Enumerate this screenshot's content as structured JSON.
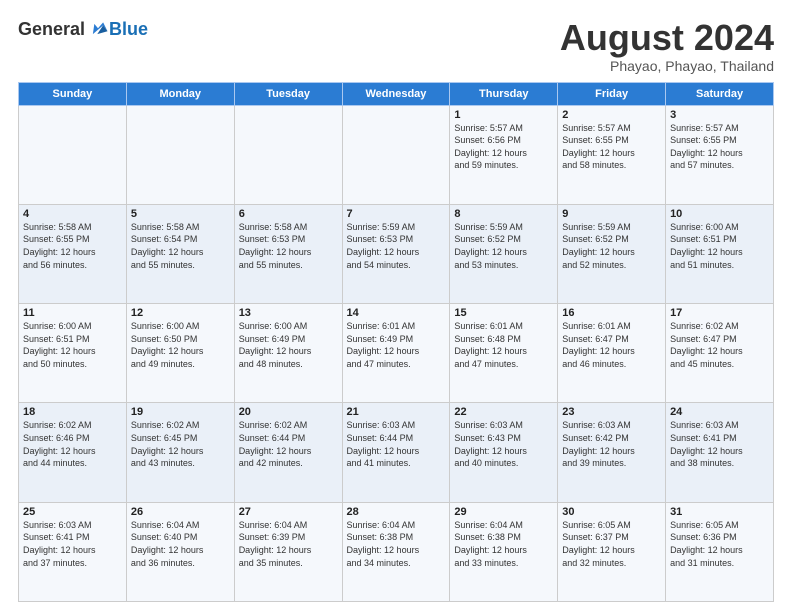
{
  "logo": {
    "general": "General",
    "blue": "Blue"
  },
  "title": {
    "month": "August 2024",
    "location": "Phayao, Phayao, Thailand"
  },
  "days_of_week": [
    "Sunday",
    "Monday",
    "Tuesday",
    "Wednesday",
    "Thursday",
    "Friday",
    "Saturday"
  ],
  "weeks": [
    [
      {
        "day": "",
        "info": ""
      },
      {
        "day": "",
        "info": ""
      },
      {
        "day": "",
        "info": ""
      },
      {
        "day": "",
        "info": ""
      },
      {
        "day": "1",
        "info": "Sunrise: 5:57 AM\nSunset: 6:56 PM\nDaylight: 12 hours\nand 59 minutes."
      },
      {
        "day": "2",
        "info": "Sunrise: 5:57 AM\nSunset: 6:55 PM\nDaylight: 12 hours\nand 58 minutes."
      },
      {
        "day": "3",
        "info": "Sunrise: 5:57 AM\nSunset: 6:55 PM\nDaylight: 12 hours\nand 57 minutes."
      }
    ],
    [
      {
        "day": "4",
        "info": "Sunrise: 5:58 AM\nSunset: 6:55 PM\nDaylight: 12 hours\nand 56 minutes."
      },
      {
        "day": "5",
        "info": "Sunrise: 5:58 AM\nSunset: 6:54 PM\nDaylight: 12 hours\nand 55 minutes."
      },
      {
        "day": "6",
        "info": "Sunrise: 5:58 AM\nSunset: 6:53 PM\nDaylight: 12 hours\nand 55 minutes."
      },
      {
        "day": "7",
        "info": "Sunrise: 5:59 AM\nSunset: 6:53 PM\nDaylight: 12 hours\nand 54 minutes."
      },
      {
        "day": "8",
        "info": "Sunrise: 5:59 AM\nSunset: 6:52 PM\nDaylight: 12 hours\nand 53 minutes."
      },
      {
        "day": "9",
        "info": "Sunrise: 5:59 AM\nSunset: 6:52 PM\nDaylight: 12 hours\nand 52 minutes."
      },
      {
        "day": "10",
        "info": "Sunrise: 6:00 AM\nSunset: 6:51 PM\nDaylight: 12 hours\nand 51 minutes."
      }
    ],
    [
      {
        "day": "11",
        "info": "Sunrise: 6:00 AM\nSunset: 6:51 PM\nDaylight: 12 hours\nand 50 minutes."
      },
      {
        "day": "12",
        "info": "Sunrise: 6:00 AM\nSunset: 6:50 PM\nDaylight: 12 hours\nand 49 minutes."
      },
      {
        "day": "13",
        "info": "Sunrise: 6:00 AM\nSunset: 6:49 PM\nDaylight: 12 hours\nand 48 minutes."
      },
      {
        "day": "14",
        "info": "Sunrise: 6:01 AM\nSunset: 6:49 PM\nDaylight: 12 hours\nand 47 minutes."
      },
      {
        "day": "15",
        "info": "Sunrise: 6:01 AM\nSunset: 6:48 PM\nDaylight: 12 hours\nand 47 minutes."
      },
      {
        "day": "16",
        "info": "Sunrise: 6:01 AM\nSunset: 6:47 PM\nDaylight: 12 hours\nand 46 minutes."
      },
      {
        "day": "17",
        "info": "Sunrise: 6:02 AM\nSunset: 6:47 PM\nDaylight: 12 hours\nand 45 minutes."
      }
    ],
    [
      {
        "day": "18",
        "info": "Sunrise: 6:02 AM\nSunset: 6:46 PM\nDaylight: 12 hours\nand 44 minutes."
      },
      {
        "day": "19",
        "info": "Sunrise: 6:02 AM\nSunset: 6:45 PM\nDaylight: 12 hours\nand 43 minutes."
      },
      {
        "day": "20",
        "info": "Sunrise: 6:02 AM\nSunset: 6:44 PM\nDaylight: 12 hours\nand 42 minutes."
      },
      {
        "day": "21",
        "info": "Sunrise: 6:03 AM\nSunset: 6:44 PM\nDaylight: 12 hours\nand 41 minutes."
      },
      {
        "day": "22",
        "info": "Sunrise: 6:03 AM\nSunset: 6:43 PM\nDaylight: 12 hours\nand 40 minutes."
      },
      {
        "day": "23",
        "info": "Sunrise: 6:03 AM\nSunset: 6:42 PM\nDaylight: 12 hours\nand 39 minutes."
      },
      {
        "day": "24",
        "info": "Sunrise: 6:03 AM\nSunset: 6:41 PM\nDaylight: 12 hours\nand 38 minutes."
      }
    ],
    [
      {
        "day": "25",
        "info": "Sunrise: 6:03 AM\nSunset: 6:41 PM\nDaylight: 12 hours\nand 37 minutes."
      },
      {
        "day": "26",
        "info": "Sunrise: 6:04 AM\nSunset: 6:40 PM\nDaylight: 12 hours\nand 36 minutes."
      },
      {
        "day": "27",
        "info": "Sunrise: 6:04 AM\nSunset: 6:39 PM\nDaylight: 12 hours\nand 35 minutes."
      },
      {
        "day": "28",
        "info": "Sunrise: 6:04 AM\nSunset: 6:38 PM\nDaylight: 12 hours\nand 34 minutes."
      },
      {
        "day": "29",
        "info": "Sunrise: 6:04 AM\nSunset: 6:38 PM\nDaylight: 12 hours\nand 33 minutes."
      },
      {
        "day": "30",
        "info": "Sunrise: 6:05 AM\nSunset: 6:37 PM\nDaylight: 12 hours\nand 32 minutes."
      },
      {
        "day": "31",
        "info": "Sunrise: 6:05 AM\nSunset: 6:36 PM\nDaylight: 12 hours\nand 31 minutes."
      }
    ]
  ]
}
